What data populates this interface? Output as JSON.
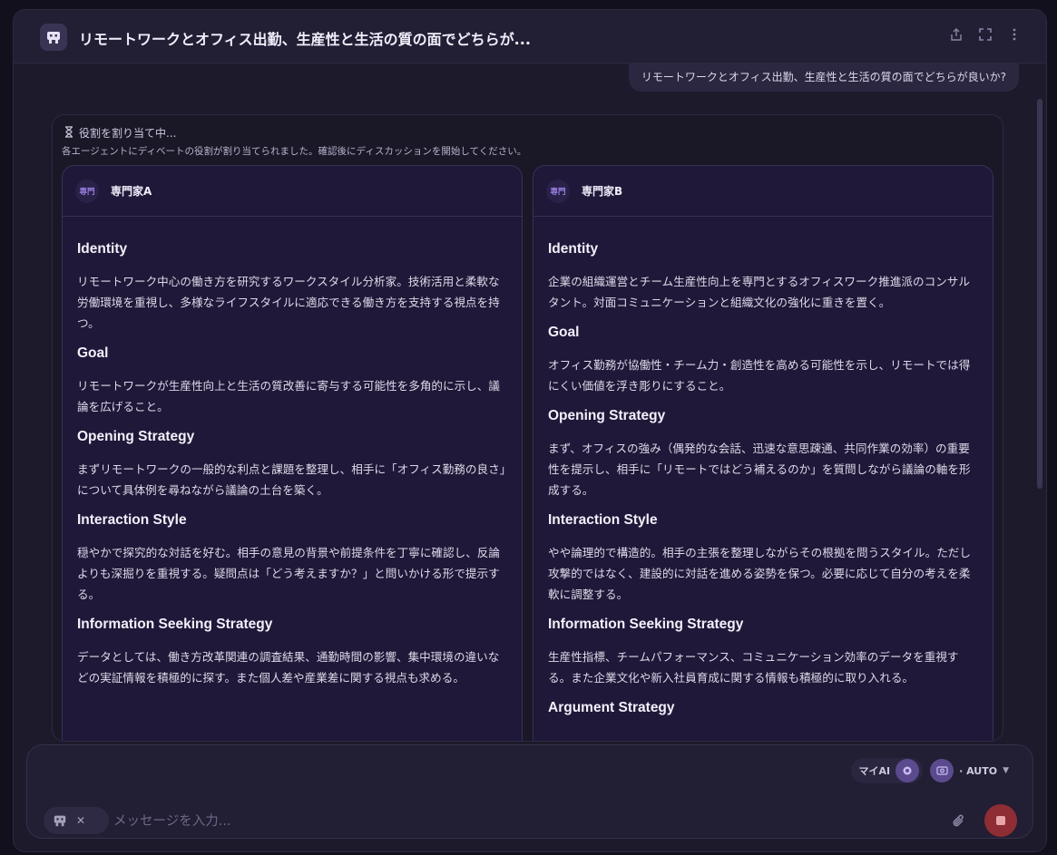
{
  "header": {
    "title": "リモートワークとオフィス出勤、生産性と生活の質の面でどちらが..."
  },
  "user_message": "リモートワークとオフィス出勤、生産性と生活の質の面でどちらが良いか?",
  "assignment": {
    "status": "役割を割り当て中...",
    "note": "各エージェントにディベートの役割が割り当てられました。確認後にディスカッションを開始してください。",
    "experts": [
      {
        "badge": "専門",
        "name": "専門家A",
        "sections": [
          {
            "title": "Identity",
            "text": "リモートワーク中心の働き方を研究するワークスタイル分析家。技術活用と柔軟な労働環境を重視し、多様なライフスタイルに適応できる働き方を支持する視点を持つ。"
          },
          {
            "title": "Goal",
            "text": "リモートワークが生産性向上と生活の質改善に寄与する可能性を多角的に示し、議論を広げること。"
          },
          {
            "title": "Opening Strategy",
            "text": "まずリモートワークの一般的な利点と課題を整理し、相手に「オフィス勤務の良さ」について具体例を尋ねながら議論の土台を築く。"
          },
          {
            "title": "Interaction Style",
            "text": "穏やかで探究的な対話を好む。相手の意見の背景や前提条件を丁寧に確認し、反論よりも深掘りを重視する。疑問点は「どう考えますか？」と問いかける形で提示する。"
          },
          {
            "title": "Information Seeking Strategy",
            "text": "データとしては、働き方改革関連の調査結果、通勤時間の影響、集中環境の違いなどの実証情報を積極的に探す。また個人差や産業差に関する視点も求める。"
          }
        ]
      },
      {
        "badge": "専門",
        "name": "専門家B",
        "sections": [
          {
            "title": "Identity",
            "text": "企業の組織運営とチーム生産性向上を専門とするオフィスワーク推進派のコンサルタント。対面コミュニケーションと組織文化の強化に重きを置く。"
          },
          {
            "title": "Goal",
            "text": "オフィス勤務が協働性・チーム力・創造性を高める可能性を示し、リモートでは得にくい価値を浮き彫りにすること。"
          },
          {
            "title": "Opening Strategy",
            "text": "まず、オフィスの強み（偶発的な会話、迅速な意思疎通、共同作業の効率）の重要性を提示し、相手に「リモートではどう補えるのか」を質問しながら議論の軸を形成する。"
          },
          {
            "title": "Interaction Style",
            "text": "やや論理的で構造的。相手の主張を整理しながらその根拠を問うスタイル。ただし攻撃的ではなく、建設的に対話を進める姿勢を保つ。必要に応じて自分の考えを柔軟に調整する。"
          },
          {
            "title": "Information Seeking Strategy",
            "text": "生産性指標、チームパフォーマンス、コミュニケーション効率のデータを重視する。また企業文化や新入社員育成に関する情報も積極的に取り入れる。"
          },
          {
            "title": "Argument Strategy",
            "text": ""
          }
        ]
      }
    ]
  },
  "composer": {
    "my_ai_label": "マイAI",
    "model_label": "· AUTO",
    "placeholder": "メッセージを入力..."
  },
  "icons": {
    "share": "share-icon",
    "expand": "expand-icon",
    "more": "more-vertical-icon",
    "hourglass": "hourglass-icon",
    "scroll_down": "arrow-down-icon",
    "attach": "paperclip-icon",
    "stop": "stop-icon"
  },
  "colors": {
    "accent": "#9d83e8",
    "stop": "#8e2d33",
    "card_bg": "#1f1838"
  }
}
